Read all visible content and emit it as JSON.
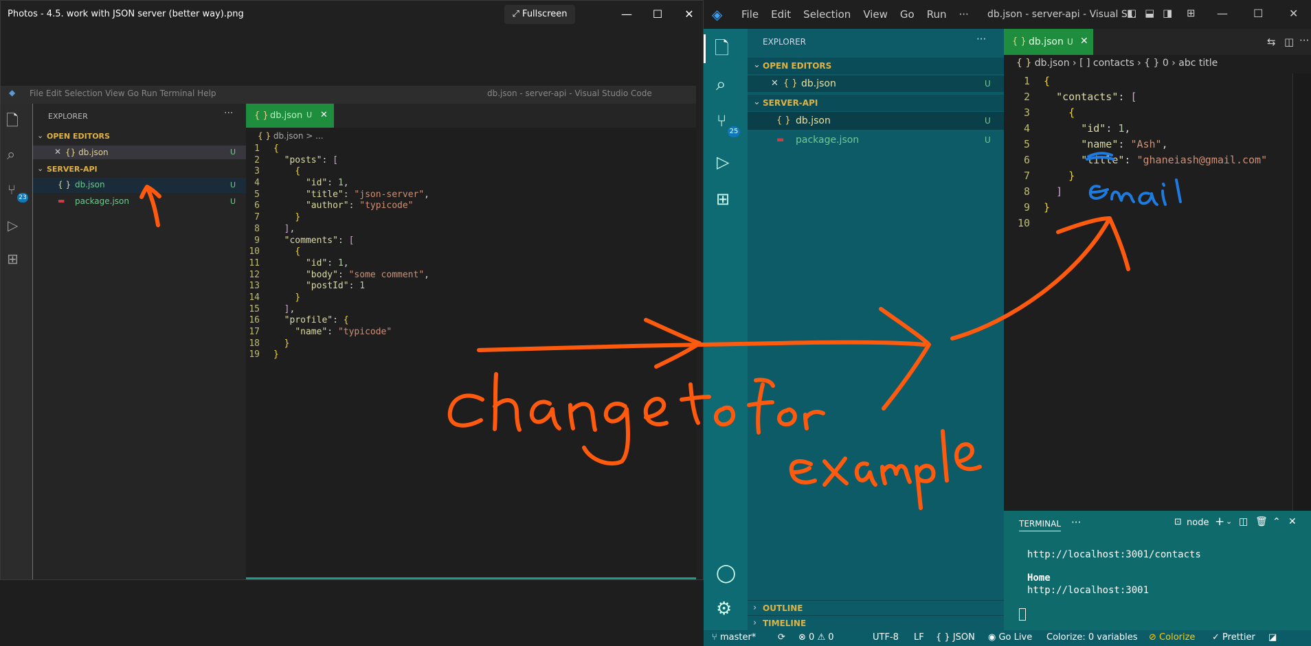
{
  "photos": {
    "title": "Photos - 4.5. work with JSON server (better way).png",
    "fullscreen_label": "Fullscreen",
    "menu_strip": "File   Edit   Selection   View   Go   Run   Terminal   Help",
    "menu_title": "db.json - server-api - Visual Studio Code"
  },
  "inner": {
    "explorer_label": "EXPLORER",
    "open_editors": "OPEN EDITORS",
    "open_file": "{} db.json",
    "u": "U",
    "project": "SERVER-API",
    "files": [
      "db.json",
      "package.json"
    ],
    "tab": "db.json",
    "breadcrumb": "db.json > ...",
    "badge": "23",
    "code": [
      "{",
      "  \"posts\": [",
      "    {",
      "      \"id\": 1,",
      "      \"title\": \"json-server\",",
      "      \"author\": \"typicode\"",
      "    }",
      "  ],",
      "  \"comments\": [",
      "    {",
      "      \"id\": 1,",
      "      \"body\": \"some comment\",",
      "      \"postId\": 1",
      "    }",
      "  ],",
      "  \"profile\": {",
      "    \"name\": \"typicode\"",
      "  }",
      "}"
    ]
  },
  "vscode": {
    "menus": [
      "File",
      "Edit",
      "Selection",
      "View",
      "Go",
      "Run",
      "···"
    ],
    "title": "db.json - server-api - Visual S...",
    "explorer_label": "EXPLORER",
    "open_editors": "OPEN EDITORS",
    "open_file": "db.json",
    "u": "U",
    "project": "SERVER-API",
    "files": [
      "db.json",
      "package.json"
    ],
    "tab": "db.json",
    "tab_u": "U",
    "breadcrumb": [
      "db.json",
      "contacts",
      "0",
      "title"
    ],
    "badge": "25",
    "outline": "OUTLINE",
    "timeline": "TIMELINE",
    "code": [
      "{",
      "  \"contacts\": [",
      "    {",
      "      \"id\": 1,",
      "      \"name\": \"Ash\",",
      "      \"title\": \"ghaneiash@gmail.com\"",
      "    }",
      "  ]",
      "}",
      ""
    ],
    "terminal": {
      "tab": "TERMINAL",
      "shell": "node",
      "line1": "http://localhost:3001/contacts",
      "home": "Home",
      "line2": "http://localhost:3001"
    },
    "status": {
      "branch": "master*",
      "errors": "0",
      "warnings": "0",
      "encoding": "UTF-8",
      "eol": "LF",
      "lang": "{ } JSON",
      "golive": "Go Live",
      "colorize": "Colorize: 0 variables",
      "colorize2": "Colorize",
      "prettier": "Prettier"
    }
  },
  "annotations": {
    "main": "Change to for example",
    "email": "email"
  },
  "colors": {
    "annotation": "#ff5a0e",
    "email_ink": "#1e7be0"
  }
}
